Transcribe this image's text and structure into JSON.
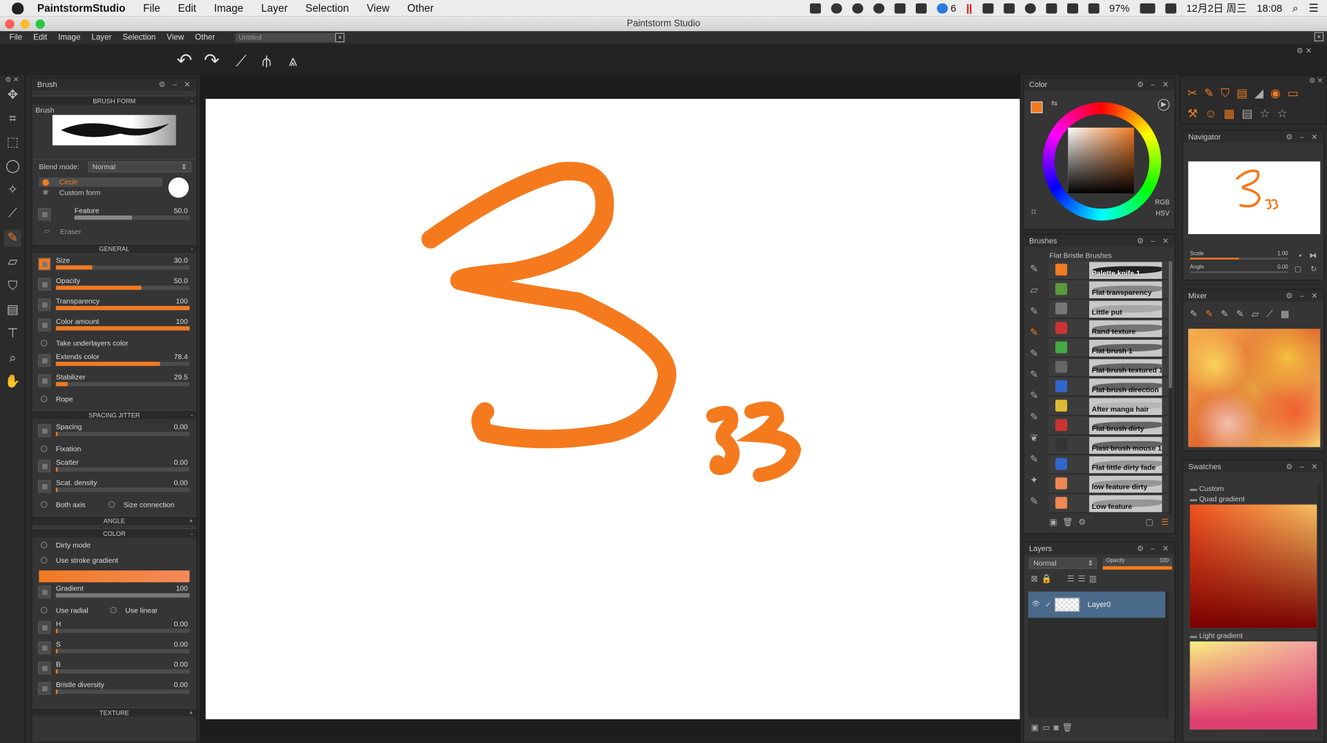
{
  "mac_menubar": {
    "app_name": "PaintstormStudio",
    "menus": [
      "File",
      "Edit",
      "Image",
      "Layer",
      "Selection",
      "View",
      "Other"
    ],
    "status": {
      "notif_count": "6",
      "battery": "97%",
      "date": "12月2日 周三",
      "time": "18:08"
    }
  },
  "window": {
    "title": "Paintstorm Studio"
  },
  "app_menu": {
    "items": [
      "File",
      "Edit",
      "Image",
      "Layer",
      "Selection",
      "View",
      "Other"
    ],
    "doc_tab": "Untitled"
  },
  "brush_panel": {
    "title": "Brush",
    "section_form": "BRUSH FORM",
    "brush_label": "Brush",
    "blend_mode_label": "Blend mode:",
    "blend_mode_value": "Normal",
    "form_circle": "Circle",
    "form_custom": "Custom form",
    "feature": {
      "label": "Feature",
      "value": "50.0",
      "fill": 0.5
    },
    "eraser": "Eraser",
    "section_general": "GENERAL",
    "size": {
      "label": "Size",
      "value": "30.0",
      "fill": 0.27
    },
    "opacity": {
      "label": "Opacity",
      "value": "50.0",
      "fill": 0.64
    },
    "transparency": {
      "label": "Transparency",
      "value": "100",
      "fill": 1.0
    },
    "color_amount": {
      "label": "Color amount",
      "value": "100",
      "fill": 1.0
    },
    "take_underlayers": "Take underlayers color",
    "extends_color": {
      "label": "Extends color",
      "value": "78.4",
      "fill": 0.78
    },
    "stabilizer": {
      "label": "Stabilizer",
      "value": "29.5",
      "fill": 0.09
    },
    "rope": "Rope",
    "section_spacing": "SPACING JITTER",
    "spacing": {
      "label": "Spacing",
      "value": "0.00",
      "fill": 0.01
    },
    "fixation": "Fixation",
    "scatter": {
      "label": "Scatter",
      "value": "0.00",
      "fill": 0.01
    },
    "scat_density": {
      "label": "Scat. density",
      "value": "0.00",
      "fill": 0.01
    },
    "both_axis": "Both axis",
    "size_connection": "Size connection",
    "section_angle": "ANGLE",
    "section_color": "COLOR",
    "dirty_mode": "Dirty mode",
    "stroke_gradient": "Use stroke gradient",
    "gradient": {
      "label": "Gradient",
      "value": "100",
      "fill": 1.0
    },
    "use_radial": "Use radial",
    "use_linear": "Use linear",
    "h": {
      "label": "H",
      "value": "0.00",
      "fill": 0.01
    },
    "s": {
      "label": "S",
      "value": "0.00",
      "fill": 0.01
    },
    "b": {
      "label": "B",
      "value": "0.00",
      "fill": 0.01
    },
    "bristle": {
      "label": "Bristle diversity",
      "value": "0.00",
      "fill": 0.01
    },
    "section_texture": "TEXTURE",
    "section_toggle_plus": "+",
    "section_toggle_minus": "-"
  },
  "color_panel": {
    "title": "Color",
    "mode_rgb": "RGB",
    "mode_hsv": "HSV",
    "current_color": "#f07a22"
  },
  "brushes_panel": {
    "title": "Brushes",
    "set_name": "Flat Bristle Brushes",
    "items": [
      "Palette knife 1",
      "Flat transparency",
      "Little put",
      "Rand texture",
      "Flat brush 1",
      "Flat brush textured 1",
      "Flat brush direction",
      "After manga hair",
      "Flat brush dirty",
      "Flast brush mouse 1",
      "Flat little dirty fade",
      "low feature dirty",
      "Low feature"
    ]
  },
  "layers_panel": {
    "title": "Layers",
    "blend": "Normal",
    "opacity_label": "Opacity",
    "opacity_value": "100",
    "layers": [
      "Layer0"
    ]
  },
  "navigator_panel": {
    "title": "Navigator",
    "scale_label": "Scale",
    "scale_value": "1.00",
    "angle_label": "Angle",
    "angle_value": "0.00"
  },
  "mixer_panel": {
    "title": "Mixer"
  },
  "swatches_panel": {
    "title": "Swatches",
    "groups": [
      "Custom",
      "Quad gradient",
      "Light gradient"
    ]
  },
  "canvas": {
    "stroke_color": "#f57a1e"
  }
}
